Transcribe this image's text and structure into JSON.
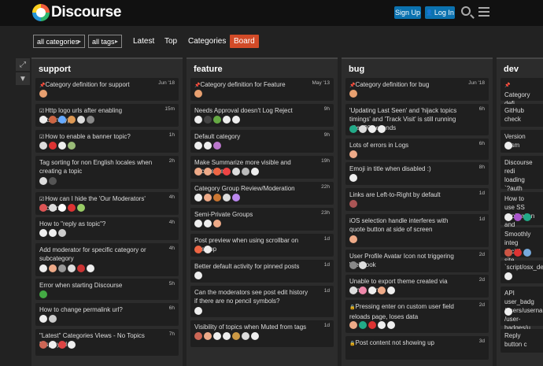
{
  "header": {
    "logo_text": "Discourse",
    "signup_label": "Sign Up",
    "login_label": "Log In"
  },
  "nav": {
    "categories_dropdown": "all categories",
    "tags_dropdown": "all tags",
    "links": [
      "Latest",
      "Top",
      "Categories",
      "Board"
    ],
    "active_link": "Board"
  },
  "columns": [
    {
      "name": "support",
      "cards": [
        {
          "title": "Category definition for support",
          "age": "Jun '18",
          "avatars": [
            "#e8a070"
          ]
        },
        {
          "title": "Http logo urls after enabling LetsEncrypt",
          "age": "15m",
          "avatars": [
            "#eee",
            "#c64",
            "#6af",
            "#d95",
            "#ddd",
            "#888"
          ]
        },
        {
          "title": "How to enable a banner topic?",
          "age": "1h",
          "avatars": [
            "#ddd",
            "#d33",
            "#eee",
            "#9b7"
          ]
        },
        {
          "title": "Tag sorting for non English locales when creating a topic",
          "age": "2h",
          "avatars": [
            "#ddd",
            "#555"
          ]
        },
        {
          "title": "How can I hide the 'Our Moderators' section?",
          "age": "4h",
          "avatars": [
            "#d55",
            "#ddd",
            "#fff",
            "#d33",
            "#9c6"
          ]
        },
        {
          "title": "How to \"reply as topic\"?",
          "age": "4h",
          "avatars": [
            "#eee",
            "#eee",
            "#ccc"
          ]
        },
        {
          "title": "Add moderator for specific category or subcategory",
          "age": "4h",
          "avatars": [
            "#eee",
            "#ea8",
            "#999",
            "#ddd",
            "#c33",
            "#eee"
          ]
        },
        {
          "title": "Error when starting Discourse",
          "age": "5h",
          "avatars": [
            "#4a4"
          ]
        },
        {
          "title": "How to change permalink url?",
          "age": "6h",
          "avatars": [
            "#eee",
            "#ccc"
          ]
        },
        {
          "title": "\"Latest\" Categories Views - No Topics Displayed",
          "age": "7h",
          "avatars": [
            "#c65",
            "#eee",
            "#d44",
            "#eee"
          ]
        }
      ]
    },
    {
      "name": "feature",
      "cards": [
        {
          "title": "Category definition for Feature",
          "age": "May '13",
          "avatars": [
            "#e8a070"
          ]
        },
        {
          "title": "Needs Approval doesn't Log Reject",
          "age": "9h",
          "avatars": [
            "#eee",
            "#444",
            "#6a4",
            "#eee",
            "#eee"
          ]
        },
        {
          "title": "Default category",
          "age": "9h",
          "avatars": [
            "#eee",
            "#eee",
            "#b7c"
          ]
        },
        {
          "title": "Make Summarize more visible and accessible",
          "age": "19h",
          "avatars": [
            "#ea8",
            "#ea8",
            "#e64",
            "#e44",
            "#ddd",
            "#bbb",
            "#eee"
          ]
        },
        {
          "title": "Category Group Review/Moderation",
          "age": "22h",
          "avatars": [
            "#eee",
            "#ea8",
            "#c73",
            "#ddd",
            "#b8e"
          ]
        },
        {
          "title": "Semi-Private Groups",
          "age": "23h",
          "avatars": [
            "#eee",
            "#eee",
            "#ea8"
          ]
        },
        {
          "title": "Post preview when using scrollbar on desktop",
          "age": "1d",
          "avatars": [
            "#e64",
            "#eee"
          ]
        },
        {
          "title": "Better default activity for pinned posts",
          "age": "1d",
          "avatars": [
            "#eee"
          ]
        },
        {
          "title": "Can the moderators see post edit history if there are no pencil symbols?",
          "age": "1d",
          "avatars": [
            "#eee"
          ]
        },
        {
          "title": "Visibility of topics when Muted from tags",
          "age": "1d",
          "avatars": [
            "#c65",
            "#ea8",
            "#eee",
            "#eee",
            "#c94",
            "#ddd",
            "#eee"
          ]
        }
      ]
    },
    {
      "name": "bug",
      "cards": [
        {
          "title": "Category definition for bug",
          "age": "Jun '18",
          "avatars": [
            "#e8a070"
          ]
        },
        {
          "title": "'Updating Last Seen' and 'hijack topics timings' and 'Track Visit' is still running after 90 seconds",
          "age": "6h",
          "avatars": [
            "#2a8",
            "#ddd",
            "#eee",
            "#eee"
          ]
        },
        {
          "title": "Lots of errors in Logs",
          "age": "6h",
          "avatars": [
            "#ea8"
          ]
        },
        {
          "title": "Emoji in title when disabled :)",
          "age": "8h",
          "avatars": [
            "#eee"
          ]
        },
        {
          "title": "Links are Left-to-Right by default",
          "age": "1d",
          "avatars": [
            "#a55"
          ]
        },
        {
          "title": "iOS selection handle interferes with quote button at side of screen",
          "age": "1d",
          "avatars": [
            "#ea8"
          ]
        },
        {
          "title": "User Profile Avatar Icon not triggering Webhook",
          "age": "2d",
          "avatars": [
            "#888",
            "#ddd"
          ]
        },
        {
          "title": "Unable to export theme created via admin panel",
          "age": "2d",
          "avatars": [
            "#ddd",
            "#e8a",
            "#eee",
            "#ea8",
            "#eee"
          ]
        },
        {
          "title": "Pressing enter on custom user field reloads page, loses data",
          "age": "2d",
          "avatars": [
            "#ea8",
            "#2a8",
            "#d33",
            "#eee",
            "#eee"
          ]
        },
        {
          "title": "Post content not showing up",
          "age": "3d",
          "avatars": []
        }
      ]
    },
    {
      "name": "dev",
      "cards": [
        {
          "title": "Category defi",
          "age": "",
          "avatars": []
        },
        {
          "title": "GitHub check",
          "age": "",
          "avatars": []
        },
        {
          "title": "Version mism",
          "age": "",
          "avatars": [
            "#eee"
          ]
        },
        {
          "title": "Discourse redi loading `?auth",
          "age": "",
          "avatars": []
        },
        {
          "title": "How to use SS application and",
          "age": "",
          "avatars": [
            "#eee",
            "#a5c",
            "#2a8"
          ]
        },
        {
          "title": "Smoothly integ social site",
          "age": "",
          "avatars": [
            "#c54",
            "#d33",
            "#7ad"
          ]
        },
        {
          "title": "`script/osx_dev`",
          "age": "",
          "avatars": [
            "#eee"
          ]
        },
        {
          "title": "API user_badg /users/usernam /user-badges/u",
          "age": "",
          "avatars": [
            "#eee"
          ]
        },
        {
          "title": "Reply button c",
          "age": "",
          "avatars": []
        }
      ]
    }
  ]
}
